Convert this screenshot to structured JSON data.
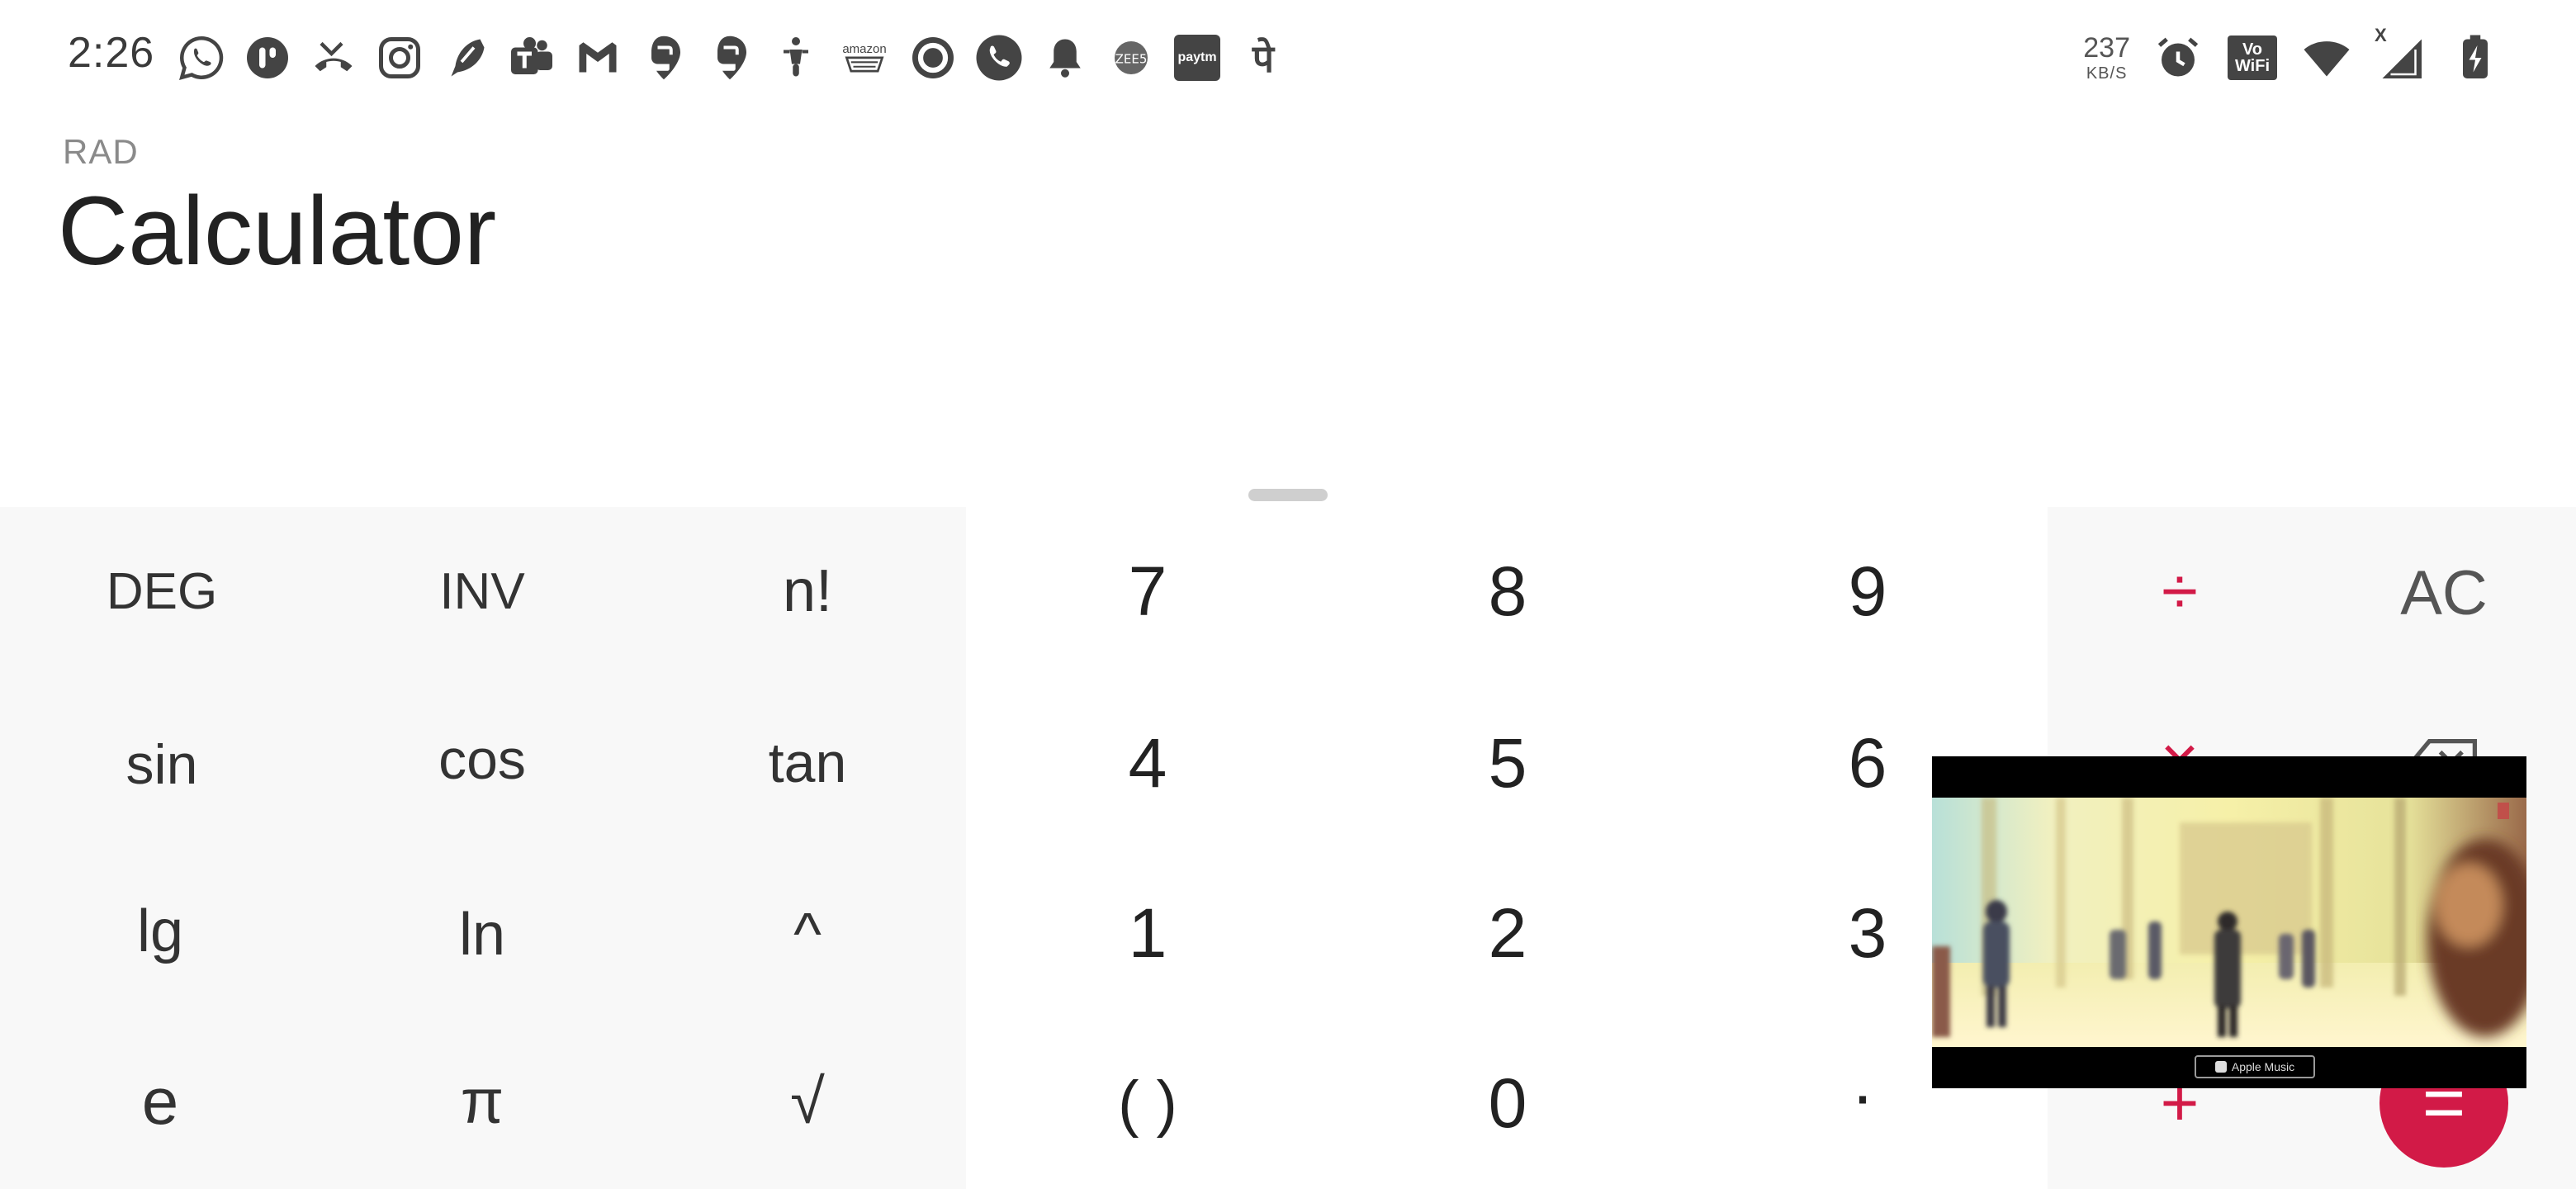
{
  "status_bar": {
    "time": "2:26",
    "left_icons": [
      "whatsapp-icon",
      "truecaller-icon",
      "missed-call-icon",
      "instagram-icon",
      "feather-app-icon",
      "teams-icon",
      "gmail-icon",
      "swiggy-icon",
      "swiggy-icon-2",
      "scooter-icon",
      "amazon-icon",
      "circle-app-icon",
      "phone-icon",
      "bell-icon",
      "zee5-icon",
      "paytm-icon",
      "phonepe-icon"
    ],
    "amazon_text": "amazon",
    "paytm_text": "paytm",
    "phonepe_text": "पे",
    "speed_value": "237",
    "speed_unit": "KB/S",
    "vowifi_top": "Vo",
    "vowifi_bottom": "WiFi",
    "signal_x": "X"
  },
  "display": {
    "mode": "RAD",
    "title": "Calculator"
  },
  "keypad": {
    "scientific": [
      [
        "DEG",
        "INV",
        "n!"
      ],
      [
        "sin",
        "cos",
        "tan"
      ],
      [
        "lg",
        "ln",
        "^"
      ],
      [
        "e",
        "π",
        "√"
      ]
    ],
    "numbers": [
      [
        "7",
        "8",
        "9"
      ],
      [
        "4",
        "5",
        "6"
      ],
      [
        "1",
        "2",
        "3"
      ],
      [
        "( )",
        "0",
        "·"
      ]
    ],
    "operators": {
      "divide": "÷",
      "multiply": "×",
      "subtract": "−",
      "add": "+",
      "clear": "AC",
      "equals": "="
    }
  },
  "pip_video": {
    "badge_text": "Apple Music"
  },
  "colors": {
    "accent": "#d21a47",
    "panel_bg": "#f8f8f8",
    "text": "#222222"
  }
}
